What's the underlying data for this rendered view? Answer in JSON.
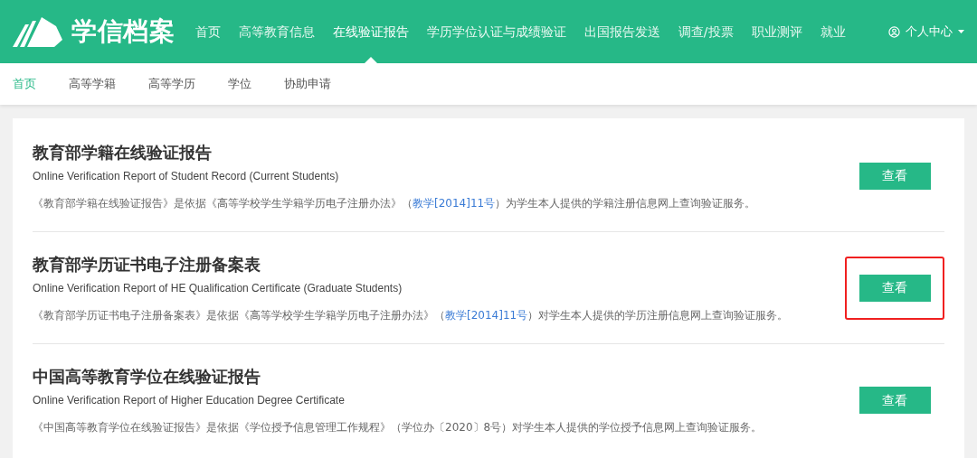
{
  "header": {
    "logo_text": "学信档案",
    "nav": [
      {
        "label": "首页",
        "selected": false
      },
      {
        "label": "高等教育信息",
        "selected": false
      },
      {
        "label": "在线验证报告",
        "selected": true
      },
      {
        "label": "学历学位认证与成绩验证",
        "selected": false
      },
      {
        "label": "出国报告发送",
        "selected": false
      },
      {
        "label": "调查/投票",
        "selected": false
      },
      {
        "label": "职业测评",
        "selected": false
      },
      {
        "label": "就业",
        "selected": false
      }
    ],
    "user_menu": "个人中心"
  },
  "subnav": [
    {
      "label": "首页",
      "selected": true
    },
    {
      "label": "高等学籍",
      "selected": false
    },
    {
      "label": "高等学历",
      "selected": false
    },
    {
      "label": "学位",
      "selected": false
    },
    {
      "label": "协助申请",
      "selected": false
    }
  ],
  "reports": [
    {
      "title": "教育部学籍在线验证报告",
      "subtitle": "Online Verification Report of Student Record (Current Students)",
      "description": [
        {
          "kind": "text",
          "text": "《教育部学籍在线验证报告》是依据《高等学校学生学籍学历电子注册办法》（"
        },
        {
          "kind": "link",
          "text": "教学[2014]11号"
        },
        {
          "kind": "text",
          "text": "）为学生本人提供的学籍注册信息网上查询验证服务。"
        }
      ],
      "button": "查看",
      "highlighted": false
    },
    {
      "title": "教育部学历证书电子注册备案表",
      "subtitle": "Online Verification Report of HE Qualification Certificate (Graduate Students)",
      "description": [
        {
          "kind": "text",
          "text": "《教育部学历证书电子注册备案表》是依据《高等学校学生学籍学历电子注册办法》（"
        },
        {
          "kind": "link",
          "text": "教学[2014]11号"
        },
        {
          "kind": "text",
          "text": "）对学生本人提供的学历注册信息网上查询验证服务。"
        }
      ],
      "button": "查看",
      "highlighted": true
    },
    {
      "title": "中国高等教育学位在线验证报告",
      "subtitle": "Online Verification Report of Higher Education Degree Certificate",
      "description": [
        {
          "kind": "text",
          "text": "《中国高等教育学位在线验证报告》是依据《学位授予信息管理工作规程》（学位办〔2020〕8号）对学生本人提供的学位授予信息网上查询验证服务。"
        }
      ],
      "button": "查看",
      "highlighted": false
    }
  ]
}
